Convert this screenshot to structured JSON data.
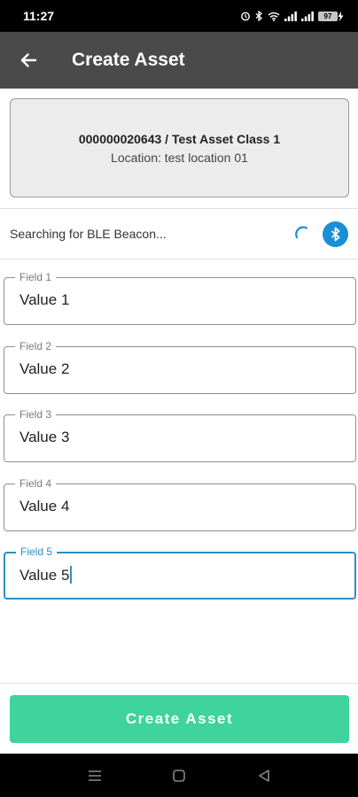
{
  "status_bar": {
    "time": "11:27",
    "battery_level": "97"
  },
  "app_bar": {
    "title": "Create Asset"
  },
  "asset": {
    "title": "000000020643 / Test Asset Class 1",
    "location": "Location: test location 01"
  },
  "ble": {
    "status_text": "Searching for BLE Beacon...",
    "accent_color": "#1a8fd6"
  },
  "fields": [
    {
      "label": "Field 1",
      "value": "Value 1"
    },
    {
      "label": "Field 2",
      "value": "Value 2"
    },
    {
      "label": "Field 3",
      "value": "Value 3"
    },
    {
      "label": "Field 4",
      "value": "Value 4"
    },
    {
      "label": "Field 5",
      "value": "Value 5",
      "focused": true
    }
  ],
  "actions": {
    "create_label": "Create Asset",
    "create_color": "#3fd39e"
  },
  "icons": {
    "back": "arrow-back-icon",
    "bluetooth": "bluetooth-icon",
    "spinner": "loading-spinner-icon",
    "nav_recents": "recents-icon",
    "nav_home": "home-icon",
    "nav_back": "back-triangle-icon"
  }
}
